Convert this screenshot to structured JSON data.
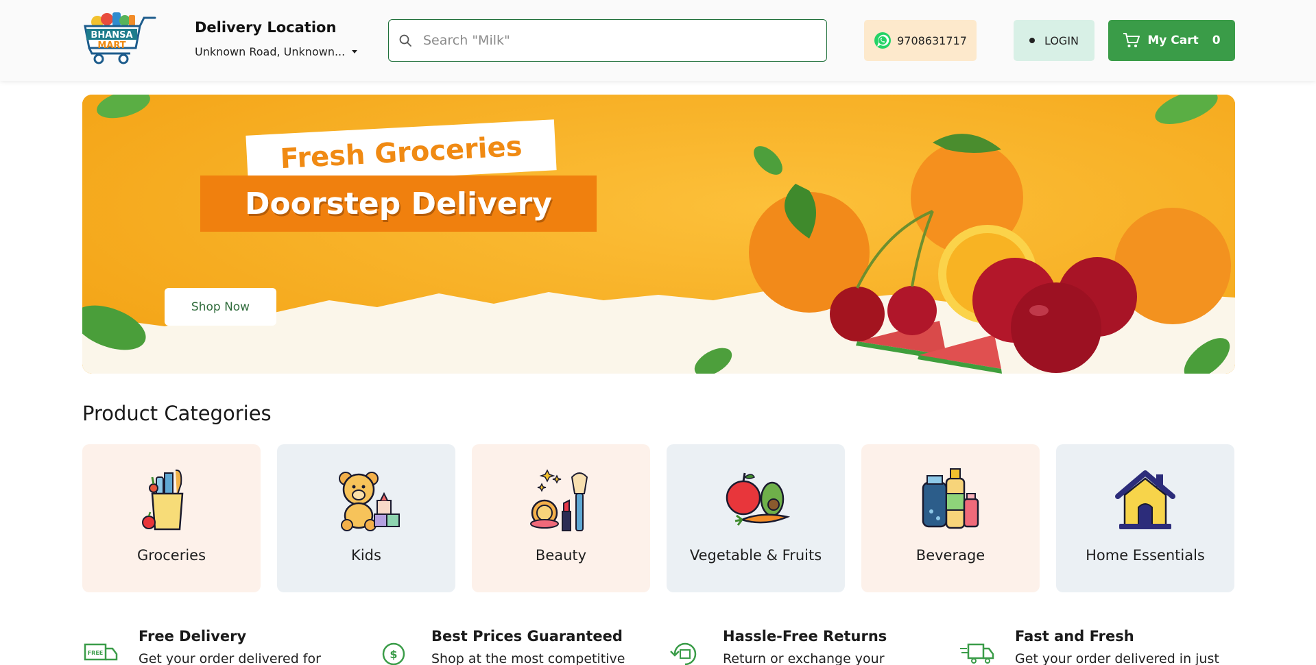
{
  "header": {
    "logo": {
      "line1": "BHANSA",
      "line2": "MART"
    },
    "delivery_title": "Delivery Location",
    "delivery_address": "Unknown Road, Unknown...",
    "search_placeholder": "Search \"Milk\"",
    "whatsapp_number": "9708631717",
    "login_label": "LOGIN",
    "cart_label": "My Cart",
    "cart_count": "0"
  },
  "banner": {
    "headline": "Fresh Groceries",
    "subheadline": "Doorstep Delivery",
    "cta_label": "Shop Now"
  },
  "categories": {
    "title": "Product Categories",
    "items": [
      {
        "label": "Groceries",
        "icon": "grocery-bag-icon"
      },
      {
        "label": "Kids",
        "icon": "teddy-bear-icon"
      },
      {
        "label": "Beauty",
        "icon": "makeup-icon"
      },
      {
        "label": "Vegetable & Fruits",
        "icon": "fruits-icon"
      },
      {
        "label": "Beverage",
        "icon": "beverage-bottles-icon"
      },
      {
        "label": "Home Essentials",
        "icon": "house-icon"
      }
    ]
  },
  "features": [
    {
      "title": "Free Delivery",
      "desc": "Get your order delivered for",
      "icon": "free-delivery-truck-icon"
    },
    {
      "title": "Best Prices Guaranteed",
      "desc": "Shop at the most competitive",
      "icon": "price-tag-icon"
    },
    {
      "title": "Hassle-Free Returns",
      "desc": "Return or exchange your",
      "icon": "returns-icon"
    },
    {
      "title": "Fast and Fresh",
      "desc": "Get your order delivered in just",
      "icon": "fast-truck-icon"
    }
  ],
  "colors": {
    "brand_green": "#3a9c48",
    "banner_orange": "#f6ab1c",
    "tag_orange": "#f0800e",
    "warm_card": "#fdf1ea",
    "cool_card": "#ebf0f4"
  }
}
